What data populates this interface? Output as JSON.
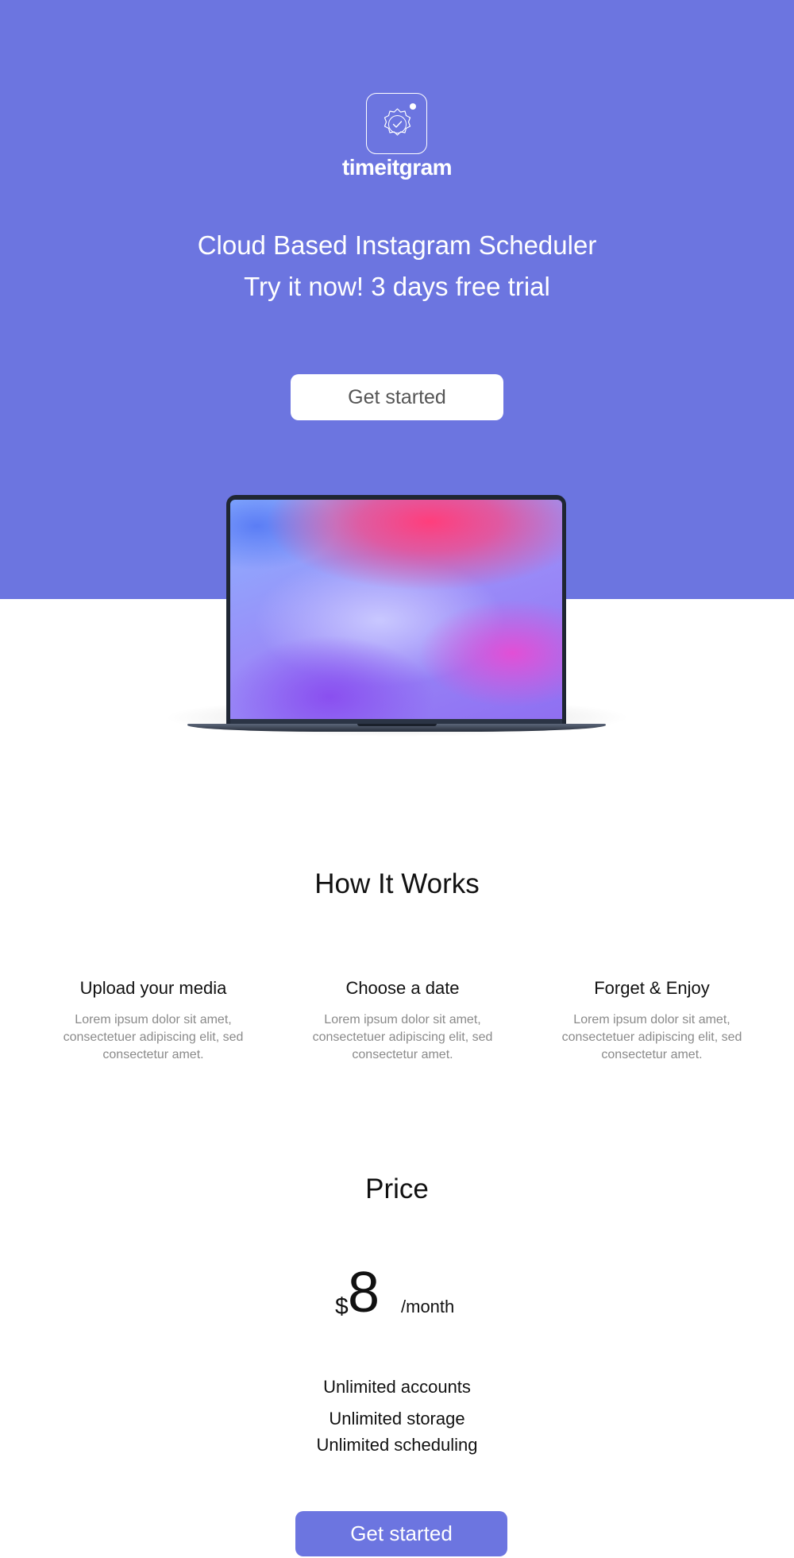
{
  "colors": {
    "brand": "#6c75e0",
    "white": "#ffffff",
    "muted_text": "#8a8a8a"
  },
  "hero": {
    "logo_icon": "badge-check-icon",
    "brand_name": "timeitgram",
    "headline_line1": "Cloud Based Instagram Scheduler",
    "headline_line2": "Try it now! 3 days free trial",
    "cta_label": "Get started",
    "device_image": "laptop-mockup"
  },
  "how_it_works": {
    "title": "How It Works",
    "steps": [
      {
        "title": "Upload your media",
        "description": "Lorem ipsum dolor sit amet, consectetuer adipiscing elit, sed consectetur amet."
      },
      {
        "title": "Choose a date",
        "description": "Lorem ipsum dolor sit amet, consectetuer adipiscing elit, sed consectetur amet."
      },
      {
        "title": "Forget & Enjoy",
        "description": "Lorem ipsum dolor sit amet, consectetuer adipiscing elit, sed consectetur amet."
      }
    ]
  },
  "pricing": {
    "title": "Price",
    "currency": "$",
    "amount": "8",
    "period": "/month",
    "features": [
      "Unlimited accounts",
      "Unlimited storage",
      "Unlimited scheduling"
    ],
    "cta_label": "Get started"
  }
}
